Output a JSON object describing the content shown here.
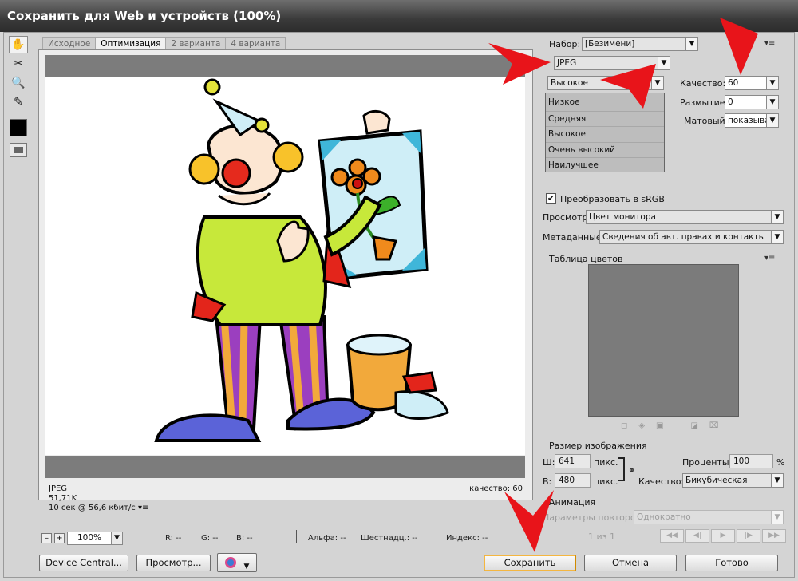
{
  "window": {
    "title": "Сохранить для Web и устройств (100%)"
  },
  "tabs": [
    "Исходное",
    "Оптимизация",
    "2 варианта",
    "4 варианта"
  ],
  "preview_status": {
    "format": "JPEG",
    "size": "51,71K",
    "time": "10 сек @ 56,6 кбит/с",
    "quality": "качество: 60"
  },
  "zoom": {
    "minus": "–",
    "plus": "+",
    "value": "100%"
  },
  "readouts": {
    "r": "R: --",
    "g": "G: --",
    "b": "B: --",
    "alpha": "Альфа: --",
    "hex": "Шестнадц.: --",
    "index": "Индекс: --"
  },
  "bottom_buttons": {
    "device_central": "Device Central...",
    "preview": "Просмотр...",
    "save": "Сохранить",
    "cancel": "Отмена",
    "done": "Готово"
  },
  "settings": {
    "preset_label": "Набор:",
    "preset_value": "[Безимени]",
    "format_value": "JPEG",
    "quality_preset_value": "Высокое",
    "quality_label": "Качество:",
    "quality_value": "60",
    "blur_label": "Размытие:",
    "blur_value": "0",
    "matte_label": "Матовый:",
    "matte_value": "показыва",
    "quality_options": [
      "Низкое",
      "Средняя",
      "Высокое",
      "Очень высокий",
      "Наилучшее"
    ],
    "convert_srgb_label": "Преобразовать в sRGB",
    "convert_srgb_checked": true,
    "preview_label": "Просмотр:",
    "preview_value": "Цвет монитора",
    "metadata_label": "Метаданные:",
    "metadata_value": "Сведения об авт. правах и контакты"
  },
  "color_table": {
    "title": "Таблица цветов"
  },
  "image_size": {
    "title": "Размер изображения",
    "width_label": "Ш:",
    "width_value": "641",
    "height_label": "В:",
    "height_value": "480",
    "unit": "пикс.",
    "percent_label": "Проценты:",
    "percent_value": "100",
    "percent_unit": "%",
    "resample_label": "Качество:",
    "resample_value": "Бикубическая"
  },
  "animation": {
    "title": "Анимация",
    "loop_label": "Параметры повторов:",
    "loop_value": "Однократно",
    "frame_counter": "1 из 1"
  },
  "colors": {
    "annotation_arrow": "#e8141a",
    "titlebar": "#3a3a3a"
  }
}
